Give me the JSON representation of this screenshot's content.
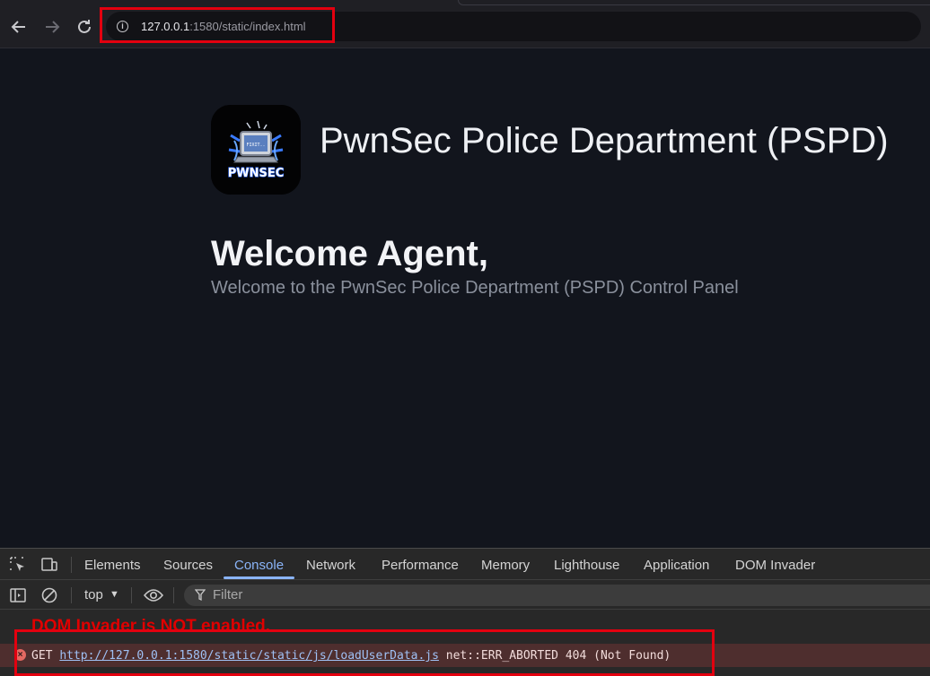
{
  "browser": {
    "url_host": "127.0.0.1",
    "url_rest": ":1580/static/index.html",
    "back_icon": "arrow-left-icon",
    "forward_icon": "arrow-right-icon",
    "reload_icon": "reload-icon"
  },
  "page": {
    "site_title": "PwnSec Police Department (PSPD)",
    "welcome_heading": "Welcome Agent,",
    "welcome_subtitle": "Welcome to the PwnSec Police Department (PSPD) Control Panel",
    "logo_text": "PWNSEC",
    "logo_screen_text": "FIXIT.."
  },
  "devtools": {
    "tabs": [
      {
        "label": "Elements"
      },
      {
        "label": "Sources"
      },
      {
        "label": "Console"
      },
      {
        "label": "Network"
      },
      {
        "label": "Performance"
      },
      {
        "label": "Memory"
      },
      {
        "label": "Lighthouse"
      },
      {
        "label": "Application"
      },
      {
        "label": "DOM Invader"
      }
    ],
    "active_tab": "Console",
    "context": "top",
    "filter_placeholder": "Filter",
    "dom_invader_message": "DOM Invader is NOT enabled.",
    "error": {
      "verb": "GET",
      "url": "http://127.0.0.1:1580/static/static/js/loadUserData.js",
      "detail": "net::ERR_ABORTED 404 (Not Found)"
    }
  },
  "colors": {
    "highlight": "#e3000f",
    "accent": "#8ab4f8",
    "error_bg": "#4e2e2e"
  }
}
